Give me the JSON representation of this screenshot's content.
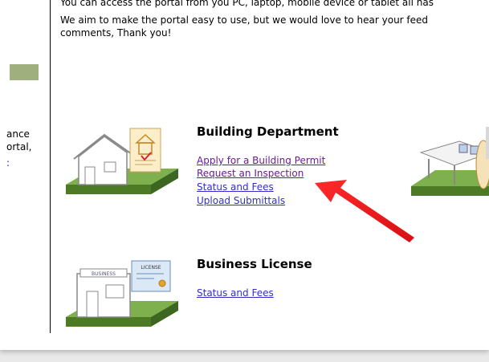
{
  "intro": {
    "line1": "You can access the portal from you PC, laptop, mobile device or tablet all has",
    "line2": "We aim to make the portal easy to use, but we would love to hear your feed",
    "line3": "comments, Thank you!"
  },
  "sidebar": {
    "text1": "ance",
    "text2": "ortal,",
    "link_fragment": ":"
  },
  "building": {
    "title": "Building Department",
    "links": [
      "Apply for a Building Permit",
      "Request an Inspection",
      "Status and Fees",
      "Upload Submittals"
    ]
  },
  "business": {
    "title": "Business License",
    "links": [
      "Status and Fees"
    ],
    "illustration_labels": {
      "sign": "BUSINESS",
      "card": "LICENSE"
    }
  },
  "colors": {
    "link": "#3030c8",
    "visited": "#6a1a9a",
    "grass": "#6a9a3a",
    "arrow": "#e8141a"
  }
}
